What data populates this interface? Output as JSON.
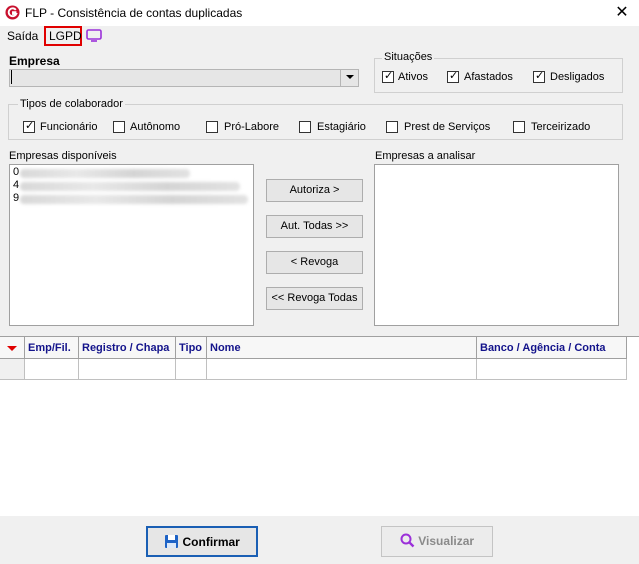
{
  "window": {
    "title": "FLP - Consistência de contas duplicadas",
    "close_glyph": "✕"
  },
  "menu": {
    "items": [
      "Saída",
      "LGPD"
    ]
  },
  "empresa": {
    "label": "Empresa",
    "value": ""
  },
  "situacoes": {
    "title": "Situações",
    "options": [
      {
        "label": "Ativos",
        "checked": true
      },
      {
        "label": "Afastados",
        "checked": true
      },
      {
        "label": "Desligados",
        "checked": true
      }
    ]
  },
  "tipos": {
    "title": "Tipos de colaborador",
    "options": [
      {
        "label": "Funcionário",
        "checked": true
      },
      {
        "label": "Autônomo",
        "checked": false
      },
      {
        "label": "Pró-Labore",
        "checked": false
      },
      {
        "label": "Estagiário",
        "checked": false
      },
      {
        "label": "Prest de Serviços",
        "checked": false
      },
      {
        "label": "Terceirizado",
        "checked": false
      }
    ]
  },
  "disponiveis": {
    "label": "Empresas disponíveis",
    "items": [
      "0",
      "4",
      "9"
    ]
  },
  "analisar": {
    "label": "Empresas a analisar",
    "items": []
  },
  "actions": {
    "autoriza": "Autoriza >",
    "aut_todas": "Aut. Todas >>",
    "revoga": "< Revoga",
    "revoga_todas": "<< Revoga Todas"
  },
  "grid": {
    "columns": [
      "Emp/Fil.",
      "Registro / Chapa",
      "Tipo",
      "Nome",
      "Banco / Agência / Conta"
    ]
  },
  "footer": {
    "confirmar": "Confirmar",
    "visualizar": "Visualizar"
  },
  "colors": {
    "accent_red": "#e00000",
    "header_text": "#13138b",
    "monitor_purple": "#9b30d9"
  },
  "icons": [
    "app-logo-icon",
    "close-icon",
    "monitor-icon",
    "chevron-down-icon",
    "save-disk-icon",
    "search-icon"
  ]
}
